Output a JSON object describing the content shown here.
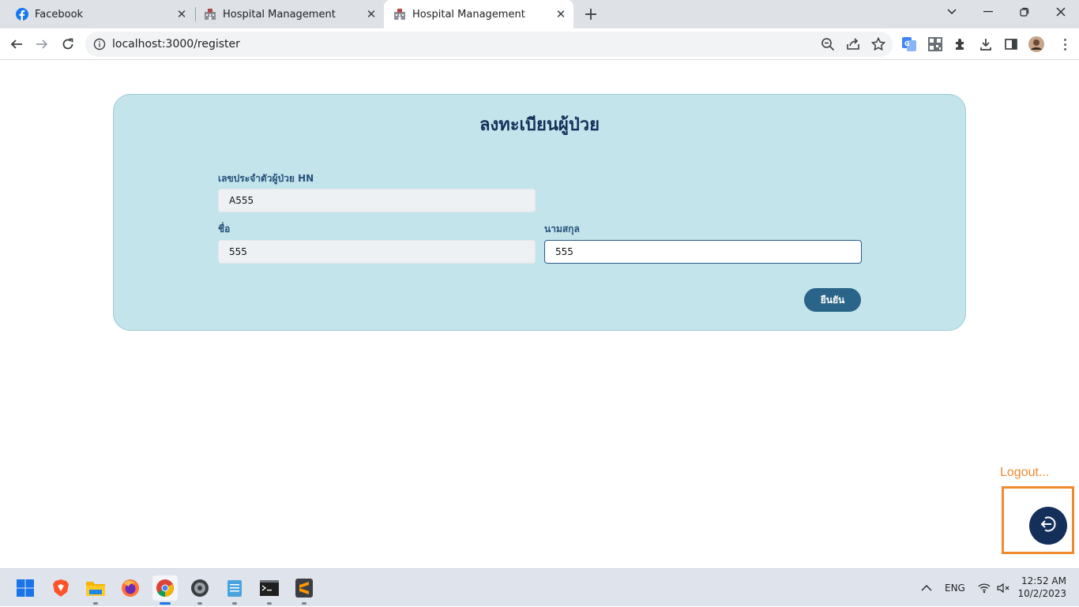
{
  "browser": {
    "tabs": [
      {
        "title": "Facebook",
        "icon": "facebook-icon"
      },
      {
        "title": "Hospital Management",
        "icon": "hospital-icon"
      },
      {
        "title": "Hospital Management",
        "icon": "hospital-icon",
        "active": true
      }
    ],
    "url": "localhost:3000/register"
  },
  "page": {
    "title": "ลงทะเบียนผู้ป่วย",
    "hn_label": "เลขประจำตัวผู้ป่วย HN",
    "hn_value": "A555",
    "firstname_label": "ชื่อ",
    "firstname_value": "555",
    "lastname_label": "นามสกุล",
    "lastname_value": "555",
    "confirm_label": "ยืนยัน",
    "logout_text": "Logout..."
  },
  "taskbar": {
    "language": "ENG",
    "time": "12:52 AM",
    "date": "10/2/2023"
  },
  "colors": {
    "card_bg": "#c4e4ec",
    "title": "#14305a",
    "button": "#2a6589",
    "logout_accent": "#f08a30"
  }
}
